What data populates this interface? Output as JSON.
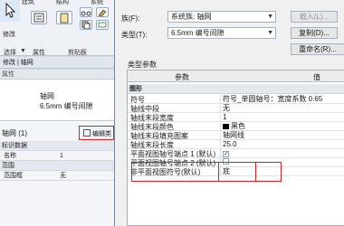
{
  "ribbon": {
    "tab_build": "建筑",
    "tab_struct": "结构",
    "tab_systems": "系统",
    "modify_label": "修改",
    "group_select": "选择",
    "group_select_arrow": "▼",
    "group_properties": "属性",
    "group_clipboard": "剪贴板"
  },
  "context_bar": "修改 | 轴网",
  "props_pane": {
    "header": "属性",
    "type_name": "轴网",
    "type_subname": "6.5mm 编号间隙",
    "instance_selector": "轴网 (1)",
    "edit_type_label": "编辑类",
    "section_identity": "标识数据",
    "name_key": "名称",
    "name_value": "1",
    "section_extents": "范围",
    "scope_box_key": "范围框",
    "scope_box_value": "无"
  },
  "dialog": {
    "family_label": "族(F):",
    "family_value": "系统族: 轴网",
    "type_label": "类型(T):",
    "type_value": "6.5mm 编号间隙",
    "load_button": "载入(L)...",
    "duplicate_button": "复制(D)...",
    "rename_button": "重命名(R)...",
    "type_params_label": "类型参数",
    "col_param": "参数",
    "col_value": "值",
    "group_graphics": "图形",
    "rows": [
      {
        "param": "符号",
        "value": "符号_单圆轴号：宽度系数 0.65"
      },
      {
        "param": "轴线中段",
        "value": "无"
      },
      {
        "param": "轴线末段宽度",
        "value": "1"
      },
      {
        "param": "轴线末段颜色",
        "value": "黑色"
      },
      {
        "param": "轴线末段填充图案",
        "value": "轴网线"
      },
      {
        "param": "轴线末段长度",
        "value": "25.0"
      },
      {
        "param": "平面视图轴号端点 1 (默认)",
        "value": "✓"
      },
      {
        "param": "平面视图轴号端点 2 (默认)",
        "value": ""
      },
      {
        "param": "非平面视图符号(默认)",
        "value": "底"
      }
    ]
  }
}
